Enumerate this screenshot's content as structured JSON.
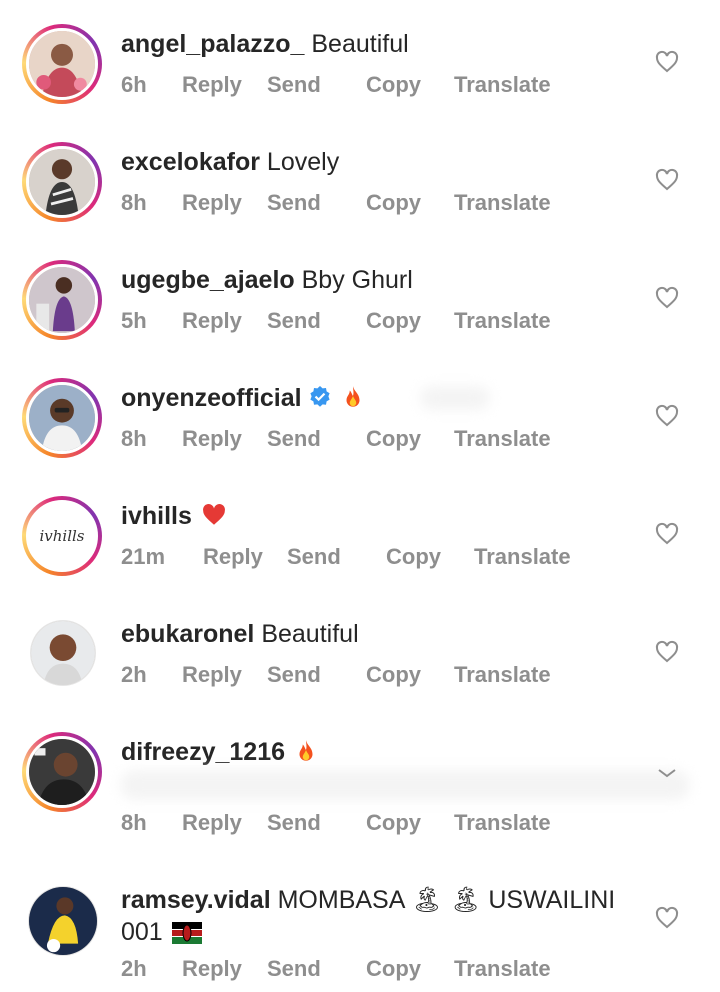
{
  "colors": {
    "text": "#262626",
    "meta": "#8e8e8e",
    "verified": "#3897f0",
    "heart_stroke": "#8e8e8e"
  },
  "comments": [
    {
      "username": "angel_palazzo_",
      "text": "Beautiful",
      "time": "6h",
      "actions": [
        "Reply",
        "Send",
        "Copy",
        "Translate"
      ],
      "avatar": "photo-woman-flowers"
    },
    {
      "username": "excelokafor",
      "text": "Lovely",
      "time": "8h",
      "actions": [
        "Reply",
        "Send",
        "Copy",
        "Translate"
      ],
      "avatar": "photo-woman"
    },
    {
      "username": "ugegbe_ajaelo",
      "text": "Bby Ghurl",
      "time": "5h",
      "actions": [
        "Reply",
        "Send",
        "Copy",
        "Translate"
      ],
      "avatar": "photo-woman-purple"
    },
    {
      "username": "onyenzeofficial",
      "text": "",
      "time": "8h",
      "actions": [
        "Reply",
        "Send",
        "Copy",
        "Translate"
      ],
      "avatar": "photo-man-glasses",
      "verified": true,
      "emoji": "fire-emoji"
    },
    {
      "username": "ivhills",
      "text": "",
      "time": "21m",
      "actions": [
        "Reply",
        "Send",
        "Copy",
        "Translate"
      ],
      "avatar": "ivhills-logo",
      "logo_text": "ivhills",
      "emoji": "red-heart-emoji"
    },
    {
      "username": "ebukaronel",
      "text": "Beautiful",
      "time": "2h",
      "actions": [
        "Reply",
        "Send",
        "Copy",
        "Translate"
      ],
      "avatar": "photo-man"
    },
    {
      "username": "difreezy_1216",
      "text": "",
      "time": "8h",
      "actions": [
        "Reply",
        "Send",
        "Copy",
        "Translate"
      ],
      "avatar": "photo-man-dark",
      "emoji": "fire-emoji"
    },
    {
      "username": "ramsey.vidal",
      "text": "MOMBASA 🏝 🏝 USWAILINI",
      "text_line2": "001",
      "time": "2h",
      "actions": [
        "Reply",
        "Send",
        "Copy",
        "Translate"
      ],
      "avatar": "photo-footballer",
      "emoji": "kenya-flag-emoji"
    }
  ]
}
